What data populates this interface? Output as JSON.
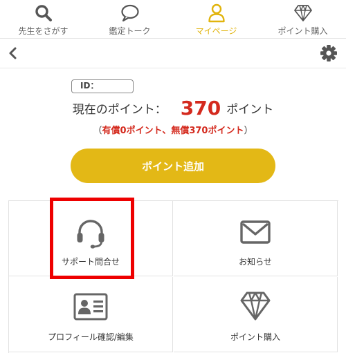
{
  "nav": {
    "items": [
      {
        "label": "先生をさがす",
        "icon": "search-icon"
      },
      {
        "label": "鑑定トーク",
        "icon": "chat-bubble-icon"
      },
      {
        "label": "マイページ",
        "icon": "person-icon",
        "active": true
      },
      {
        "label": "ポイント購入",
        "icon": "diamond-icon"
      }
    ]
  },
  "header": {
    "back_icon": "chevron-left-icon",
    "settings_icon": "gear-icon"
  },
  "profile": {
    "id_label": "ID："
  },
  "points": {
    "label": "現在のポイント：",
    "value": "370",
    "unit": "ポイント",
    "paren_open": "（",
    "breakdown": "有償0ポイント、無償370ポイント",
    "paren_close": "）"
  },
  "add_button": {
    "label": "ポイント追加"
  },
  "menu": {
    "items": [
      {
        "label": "サポート問合せ",
        "icon": "headset-icon"
      },
      {
        "label": "お知らせ",
        "icon": "envelope-icon"
      },
      {
        "label": "プロフィール確認/編集",
        "icon": "id-card-icon"
      },
      {
        "label": "ポイント購入",
        "icon": "diamond-icon"
      }
    ]
  },
  "colors": {
    "accent": "#e3b816",
    "points_red": "#d42a1e",
    "highlight": "#ee0000"
  }
}
